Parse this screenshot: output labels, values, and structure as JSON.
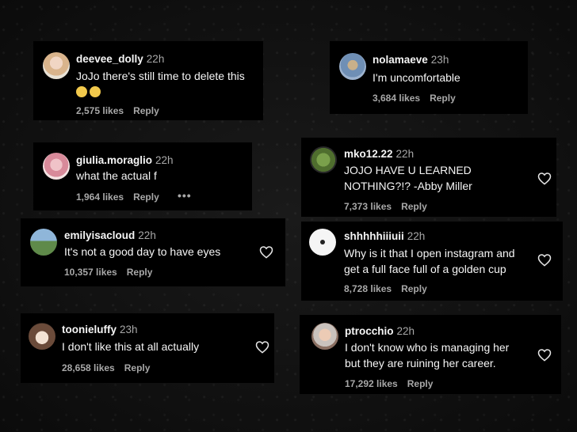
{
  "comments": [
    {
      "user": "deevee_dolly",
      "time": "22h",
      "text": "JoJo there's still time to delete this",
      "emoji": [
        "flushed-face",
        "flushed-face"
      ],
      "likes": "2,575 likes",
      "reply": "Reply"
    },
    {
      "user": "nolamaeve",
      "time": "23h",
      "text": "I'm uncomfortable",
      "likes": "3,684 likes",
      "reply": "Reply"
    },
    {
      "user": "giulia.moraglio",
      "time": "22h",
      "text": "what the actual f",
      "likes": "1,964 likes",
      "reply": "Reply",
      "more": "•••"
    },
    {
      "user": "mko12.22",
      "time": "22h",
      "text_lines": [
        "JOJO HAVE U LEARNED",
        "NOTHING?!? -Abby Miller"
      ],
      "likes": "7,373 likes",
      "reply": "Reply"
    },
    {
      "user": "emilyisacloud",
      "time": "22h",
      "text": "It's not a good day to have eyes",
      "likes": "10,357 likes",
      "reply": "Reply"
    },
    {
      "user": "shhhhhiiiuii",
      "time": "22h",
      "text_lines": [
        "Why is it that I open instagram and",
        "get a full face full of a golden cup"
      ],
      "likes": "8,728 likes",
      "reply": "Reply"
    },
    {
      "user": "toonieluffy",
      "time": "23h",
      "text": "I don't like this at all actually",
      "likes": "28,658 likes",
      "reply": "Reply"
    },
    {
      "user": "ptrocchio",
      "time": "22h",
      "text_lines": [
        "I don't know who is managing her",
        "but they are ruining her career."
      ],
      "likes": "17,292 likes",
      "reply": "Reply"
    }
  ]
}
